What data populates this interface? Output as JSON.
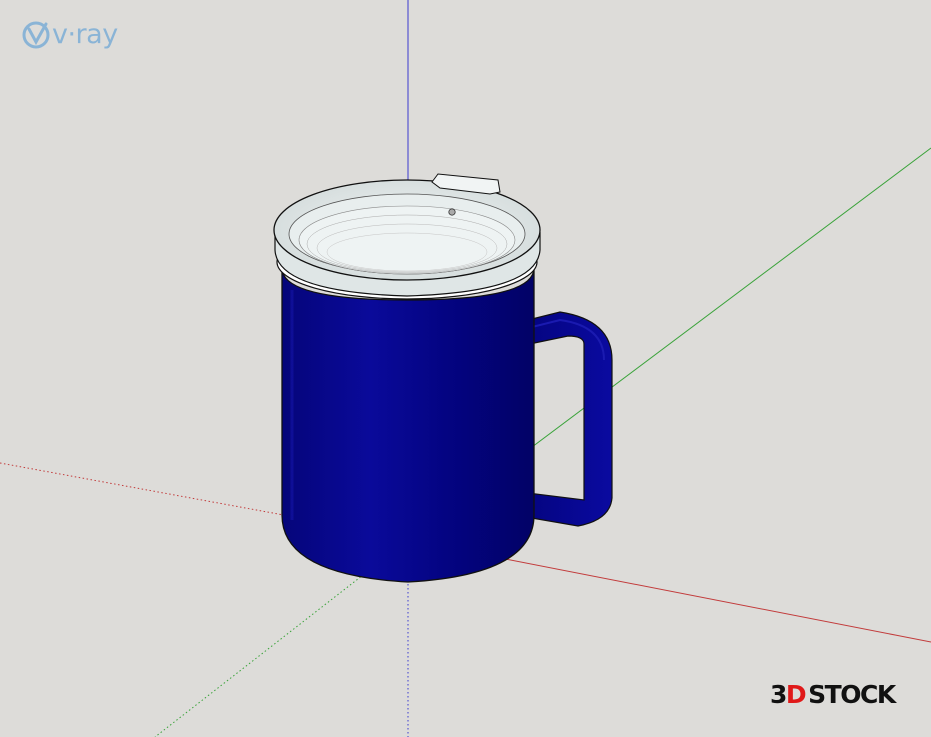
{
  "viewport": {
    "background_color": "#dddcd9"
  },
  "axes": {
    "red_color": "#c23b3b",
    "green_color": "#3aa33a",
    "blue_color": "#3a3ad0"
  },
  "model": {
    "mug_body_color": "#03038a",
    "mug_highlight_color": "#1a1aa8",
    "lid_color": "#e6ecec",
    "outline_color": "#111111"
  },
  "watermarks": {
    "vray": {
      "icon": "vray-v-icon",
      "text": "v·ray",
      "color": "#6fa7d6"
    },
    "stock": {
      "prefix": "3",
      "accent": "D",
      "suffix": "STOCK",
      "accent_color": "#e01919"
    }
  }
}
